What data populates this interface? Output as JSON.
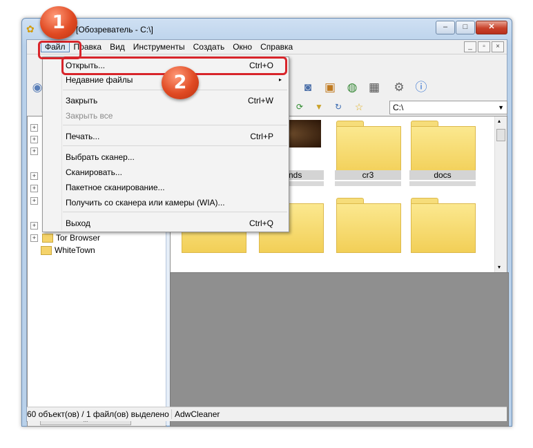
{
  "window": {
    "title": "[Обозреватель - C:\\]",
    "controls": [
      "–",
      "□",
      "✕"
    ]
  },
  "menubar": {
    "items": [
      "Файл",
      "Правка",
      "Вид",
      "Инструменты",
      "Создать",
      "Окно",
      "Справка"
    ],
    "mdi_controls": [
      "_",
      "▫",
      "×"
    ]
  },
  "address": {
    "value": "C:\\"
  },
  "tree": {
    "items": [
      "Tor Browser",
      "WhiteTown"
    ]
  },
  "files": {
    "items": [
      {
        "label": "ounds"
      },
      {
        "label": "cr3"
      },
      {
        "label": "docs"
      }
    ]
  },
  "statusbar": {
    "selection": "60 объект(ов) / 1 файл(ов) выделено",
    "item": "AdwCleaner"
  },
  "file_menu": {
    "items": [
      {
        "label": "Открыть...",
        "shortcut": "Ctrl+O"
      },
      {
        "label": "Недавние файлы",
        "submenu": "▸"
      },
      {
        "label": "Закрыть",
        "shortcut": "Ctrl+W"
      },
      {
        "label": "Закрыть все",
        "disabled": true
      },
      {
        "label": "Печать...",
        "shortcut": "Ctrl+P"
      },
      {
        "label": "Выбрать сканер..."
      },
      {
        "label": "Сканировать..."
      },
      {
        "label": "Пакетное сканирование..."
      },
      {
        "label": "Получить со сканера или камеры (WIA)..."
      },
      {
        "label": "Выход",
        "shortcut": "Ctrl+Q"
      }
    ]
  },
  "annotations": {
    "step1": "1",
    "step2": "2",
    "color": "#d8242a"
  },
  "scrollbar": {
    "hthumb_glyph": "III"
  }
}
